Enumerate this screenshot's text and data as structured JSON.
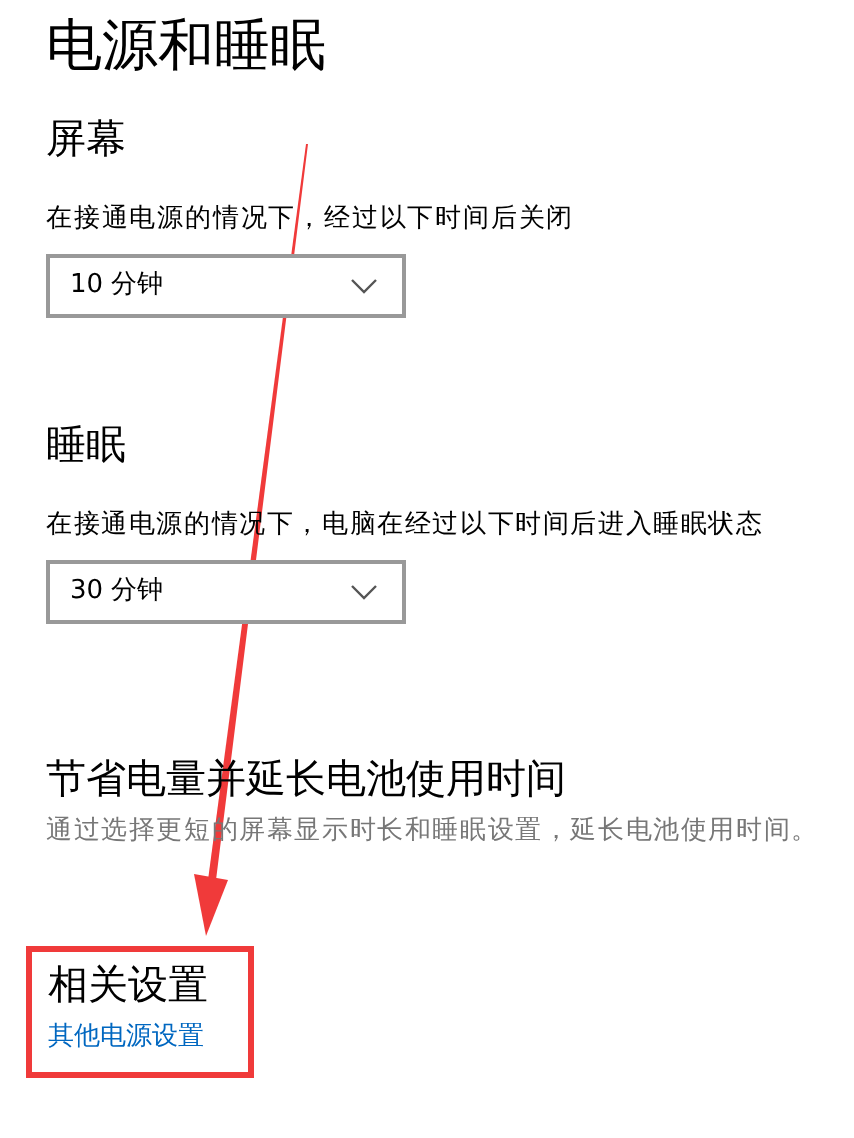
{
  "title": "电源和睡眠",
  "screen": {
    "heading": "屏幕",
    "label": "在接通电源的情况下，经过以下时间后关闭",
    "dropdown": {
      "value": "10 分钟"
    }
  },
  "sleep": {
    "heading": "睡眠",
    "label": "在接通电源的情况下，电脑在经过以下时间后进入睡眠状态",
    "dropdown": {
      "value": "30 分钟"
    }
  },
  "battery": {
    "heading": "节省电量并延长电池使用时间",
    "description": "通过选择更短的屏幕显示时长和睡眠设置，延长电池使用时间。"
  },
  "related": {
    "heading": "相关设置",
    "link": "其他电源设置"
  }
}
